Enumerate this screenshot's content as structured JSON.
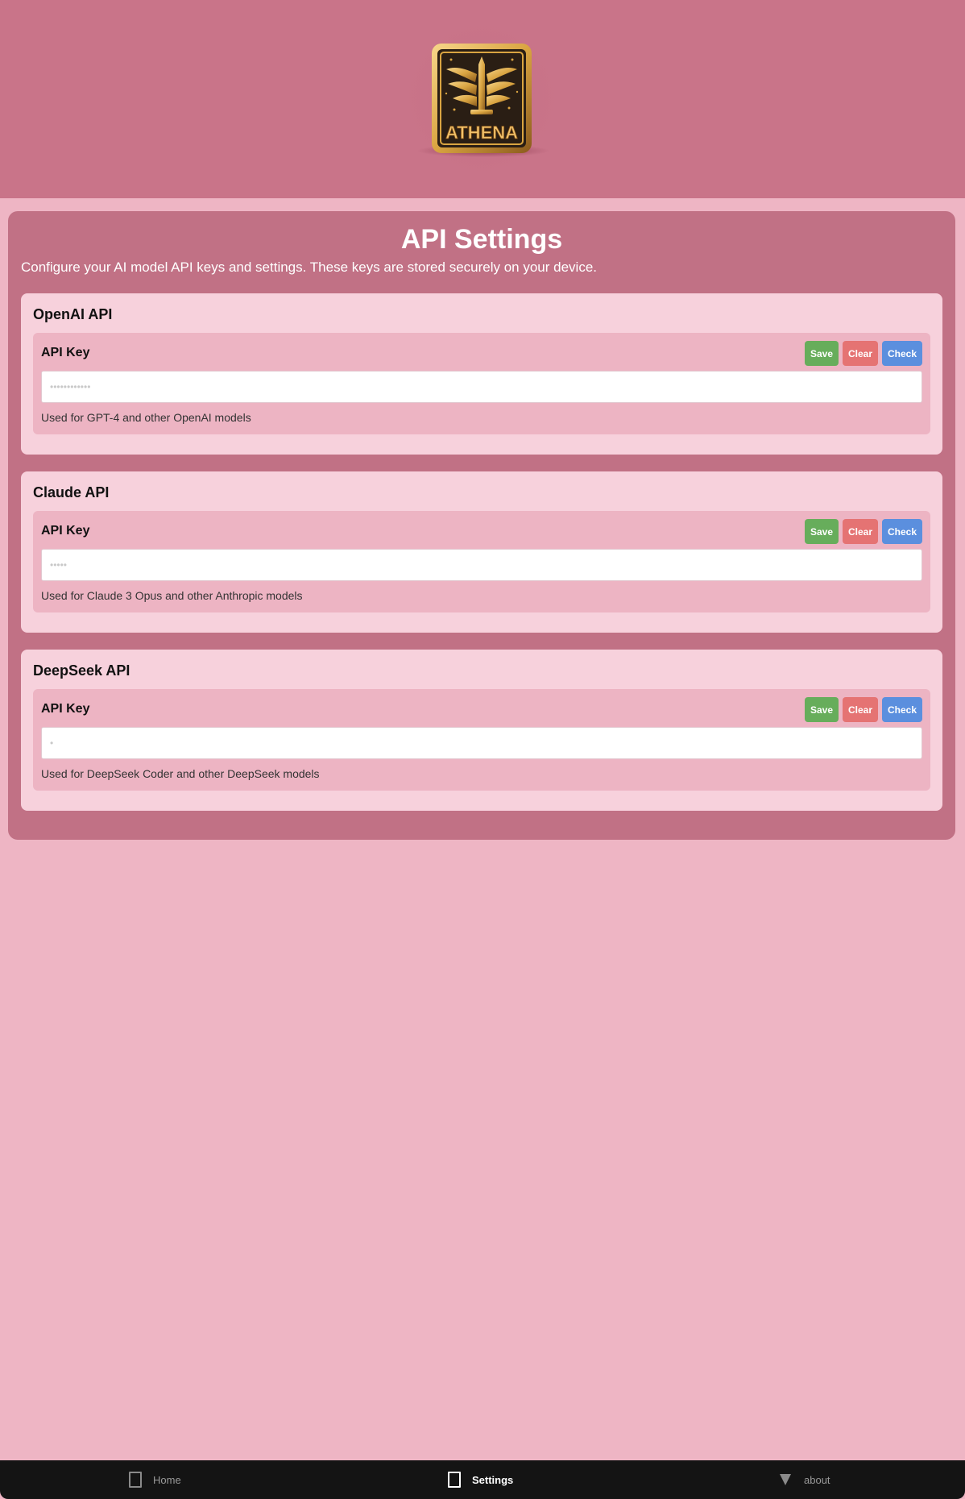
{
  "header": {
    "logo_text": "ATHENA",
    "logo_icon": "winged-sword-emblem-icon"
  },
  "page": {
    "title": "API Settings",
    "subtitle": "Configure your AI model API keys and settings. These keys are stored securely on your device."
  },
  "cards": [
    {
      "title": "OpenAI API",
      "field_label": "API Key",
      "placeholder": "••••••••••••",
      "value": "",
      "help": "Used for GPT-4 and other OpenAI models"
    },
    {
      "title": "Claude API",
      "field_label": "API Key",
      "placeholder": "•••••",
      "value": "",
      "help": "Used for Claude 3 Opus and other Anthropic models"
    },
    {
      "title": "DeepSeek API",
      "field_label": "API Key",
      "placeholder": "•",
      "value": "",
      "help": "Used for DeepSeek Coder and other DeepSeek models"
    }
  ],
  "buttons": {
    "save": "Save",
    "clear": "Clear",
    "check": "Check"
  },
  "nav": {
    "items": [
      {
        "label": "Home",
        "icon": "square-icon",
        "active": false
      },
      {
        "label": "Settings",
        "icon": "square-icon",
        "active": true
      },
      {
        "label": "about",
        "icon": "triangle-down-icon",
        "active": false
      }
    ]
  },
  "colors": {
    "header_bg": "#c97489",
    "page_bg": "#eeb5c4",
    "panel_bg": "#c17185",
    "card_bg": "#f7d1dc",
    "inner_bg": "#edb4c3",
    "save": "#67ad5b",
    "clear": "#e57373",
    "check": "#5b8fde",
    "nav_bg": "#141414"
  }
}
